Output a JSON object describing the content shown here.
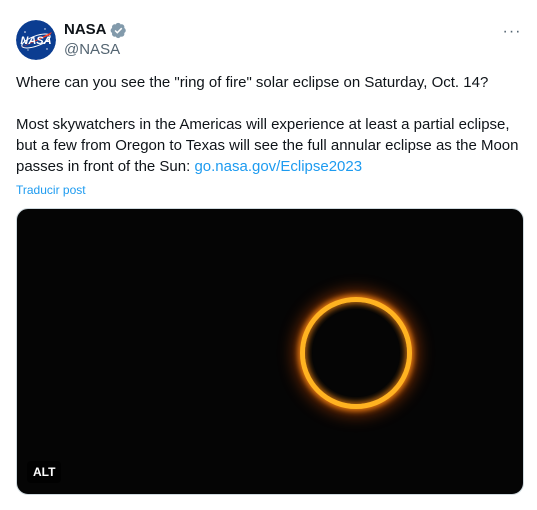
{
  "author": {
    "display_name": "NASA",
    "handle": "@NASA",
    "avatar_icon": "nasa-meatball-logo",
    "avatar_logo_text": "NASA",
    "verified_icon": "verified-badge-icon",
    "verified_color": "#829aab"
  },
  "more_button": {
    "label": "···",
    "icon": "more-horizontal-icon"
  },
  "tweet": {
    "line1": "Where can you see the \"ring of fire\" solar eclipse on Saturday, Oct. 14?",
    "line2": "Most skywatchers in the Americas will experience at least a partial eclipse, but a few from Oregon to Texas will see the full annular eclipse as the Moon passes in front of the Sun: ",
    "link_text": "go.nasa.gov/Eclipse2023",
    "translate_label": "Traducir post"
  },
  "media": {
    "alt_label": "ALT",
    "colors": {
      "background": "#050505",
      "ring": "#ffb321",
      "glow": "#ff8c14"
    }
  },
  "colors": {
    "text": "#0f1419",
    "secondary": "#536471",
    "link": "#1d9bf0"
  }
}
